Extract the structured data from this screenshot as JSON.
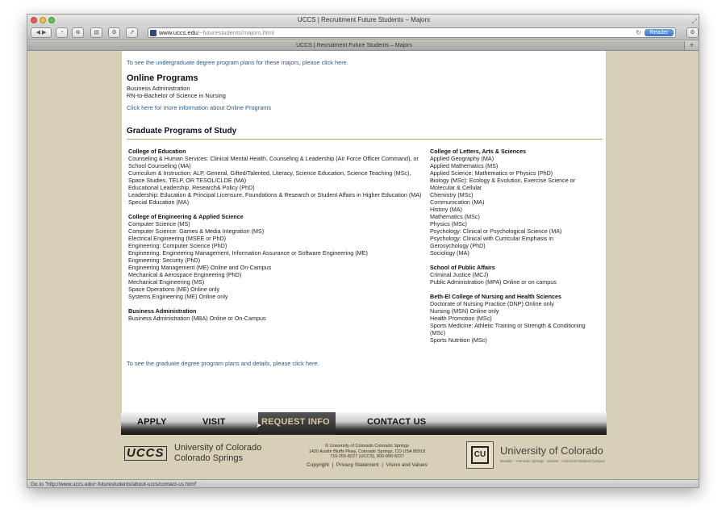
{
  "window": {
    "title": "UCCS | Recruitment Future Students – Majors"
  },
  "toolbar": {
    "url_host": "www.uccs.edu",
    "url_path": "/~futurestudents/majors.html",
    "reader_label": "Reader"
  },
  "tab": {
    "label": "UCCS | Recruitment Future Students – Majors",
    "new_tab": "+"
  },
  "page": {
    "undergrad_link": "To see the undergraduate degree program plans for these majors, please click here.",
    "online": {
      "heading": "Online Programs",
      "items": [
        "Business Administration",
        "RN-to-Bachelor of Science in Nursing"
      ],
      "link": "Click here for more information about Online Programs"
    },
    "graduate_heading": "Graduate Programs of Study",
    "left_column": [
      {
        "title": "College of Education",
        "rows": [
          "Counseling & Human Services: Clinical Mental Health, Counseling & Leadership (Air Force Officer Command), or School Counseling (MA)",
          "Curriculum & Instruction: ALP, General, Gifted/Talented, Literacy, Science Education, Science Teaching (MSc), Space Studies, TELP, OR TESOL/CLDE (MA)",
          "Educational Leadership, Research& Policy (PhD)",
          "Leadership: Education & Principal Licensure, Foundations & Research or Student Affairs in Higher Education (MA)",
          "Special Education (MA)"
        ]
      },
      {
        "title": "College of Engineering & Applied Science",
        "rows": [
          "Computer Science (MS)",
          "Computer Science: Games & Media Integration (MS)",
          "Electrical Engineering (MSEE or PhD)",
          "Engineering: Computer Science (PhD)",
          "Engineering: Engineering Management, Information Assurance or Software Engineering (ME)",
          "Engineering: Security (PhD)",
          "Engineering Management (ME) Online and On-Campus",
          "Mechanical & Aerospace Engineering (PhD)",
          "Mechanical Engineering (MS)",
          "Space Operations (ME) Online only",
          "Systems Engineering (ME) Online only"
        ]
      },
      {
        "title": "Business Administration",
        "rows": [
          "Business Administration (MBA) Online or On-Campus"
        ]
      }
    ],
    "right_column": [
      {
        "title": "College of Letters, Arts & Sciences",
        "rows": [
          "Applied Geography (MA)",
          "Applied Mathematics (MS)",
          "Applied Science: Mathematics or Physics (PhD)",
          "Biology (MSc): Ecology & Evolution, Exercise Science or Molecular & Cellular",
          "Chemistry (MSc)",
          "Communication (MA)",
          "History (MA)",
          "Mathematics (MSc)",
          "Physics (MSc)",
          "Psychology: Clinical or Psychological Science (MA)",
          "Psychology: Clinical with Curricular Emphasis in Gerosychology (PhD)",
          "Sociology (MA)"
        ]
      },
      {
        "title": "School of Public Affairs",
        "rows": [
          "Criminal Justice (MCJ)",
          "Public Administration (MPA) Online or on campus"
        ]
      },
      {
        "title": "Beth-El College of Nursing and Health Sciences",
        "rows": [
          "Doctorate of Nursing Practice (DNP) Online only",
          "Nursing (MSN) Online only",
          "Health Promotion (MSc)",
          "Sports Medicine: Athletic Training or Strength & Conditioning (MSc)",
          "Sports Nutrition (MSc)"
        ]
      }
    ],
    "graduate_link": "To see the graduate degree program plans and details, please click here."
  },
  "nav": {
    "apply": "APPLY",
    "visit": "VISIT",
    "request_info": "REQUEST INFO",
    "contact": "CONTACT US"
  },
  "footer": {
    "logo_text": "UCCS",
    "uccs_line1": "University of Colorado",
    "uccs_line2": "Colorado Springs",
    "address_lines": [
      "© University of Colorado Colorado Springs",
      "1420 Austin Bluffs Pkwy, Colorado Springs, CO USA 80918",
      "719-255-8227 (UCCS), 800-990-8227"
    ],
    "copyright_link": "Copyright",
    "privacy_link": "Privacy Statement",
    "vision_link": "Vision and Values",
    "separator": "|",
    "cu_emblem": "CU",
    "cu_name": "University of Colorado",
    "cu_campuses": "Boulder · Colorado Springs · Denver · Anschutz Medical Campus"
  },
  "status": {
    "text": "Go to \"http://www.uccs.edu/~futurestudents/about-uccs/contact-us.html\""
  }
}
